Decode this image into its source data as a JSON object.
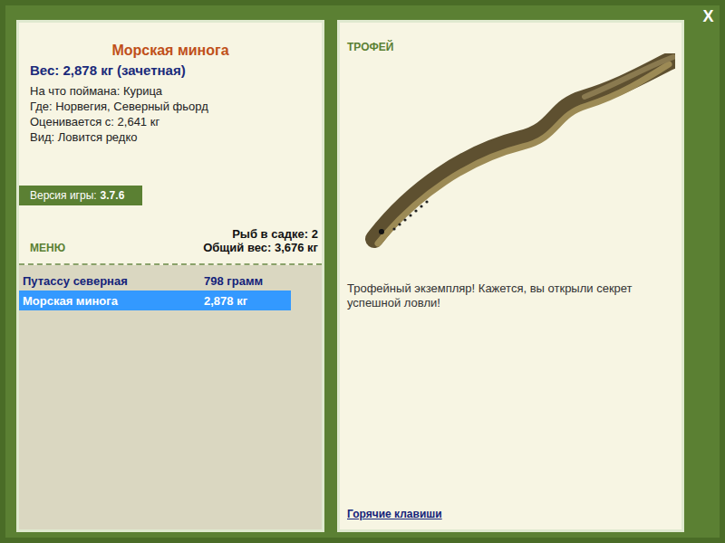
{
  "close": "X",
  "fish": {
    "name": "Морская минога",
    "weight": "Вес: 2,878 кг (зачетная)",
    "details": [
      "На что поймана: Курица",
      "Где: Норвегия, Северный фьорд",
      "Оценивается с: 2,641 кг",
      "Вид: Ловится редко"
    ]
  },
  "version": {
    "label": "Версия игры:",
    "value": "3.7.6"
  },
  "menu": "МЕНЮ",
  "keepnet": {
    "count": "Рыб в садке: 2",
    "total": "Общий вес: 3,676 кг"
  },
  "catch": [
    {
      "name": "Путассу северная",
      "weight": "798 грамм",
      "selected": false
    },
    {
      "name": "Морская минога",
      "weight": "2,878 кг",
      "selected": true
    }
  ],
  "trophy": {
    "label": "ТРОФЕЙ",
    "message": "Трофейный экземпляр! Кажется, вы открыли секрет успешной ловли!"
  },
  "hotkeys": "Горячие клавиши"
}
